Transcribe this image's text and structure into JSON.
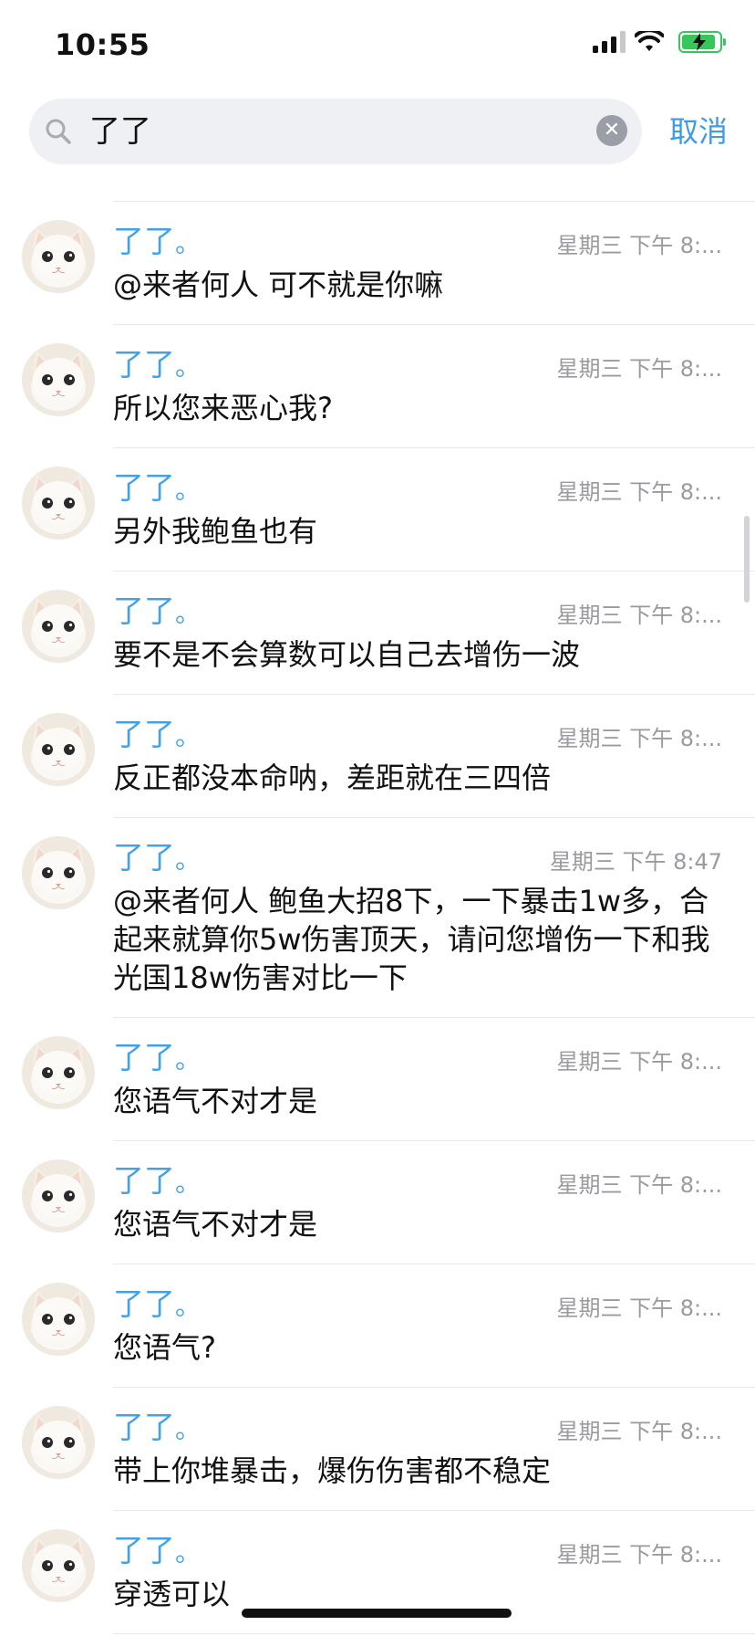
{
  "status_bar": {
    "time": "10:55"
  },
  "search": {
    "query": "了了",
    "cancel_label": "取消"
  },
  "colors": {
    "accent": "#43a2e6",
    "link": "#3d9be9",
    "battery": "#35c759"
  },
  "messages": [
    {
      "name": "了了",
      "dot": "。",
      "time": "星期三 下午 8:...",
      "text": "@来者何人 可不就是你嘛"
    },
    {
      "name": "了了",
      "dot": "。",
      "time": "星期三 下午 8:...",
      "text": "所以您来恶心我?"
    },
    {
      "name": "了了",
      "dot": "。",
      "time": "星期三 下午 8:...",
      "text": "另外我鲍鱼也有"
    },
    {
      "name": "了了",
      "dot": "。",
      "time": "星期三 下午 8:...",
      "text": "要不是不会算数可以自己去增伤一波"
    },
    {
      "name": "了了",
      "dot": "。",
      "time": "星期三 下午 8:...",
      "text": "反正都没本命呐，差距就在三四倍"
    },
    {
      "name": "了了",
      "dot": "。",
      "time": "星期三 下午 8:47",
      "text": "@来者何人 鲍鱼大招8下，一下暴击1w多，合起来就算你5w伤害顶天，请问您增伤一下和我光国18w伤害对比一下"
    },
    {
      "name": "了了",
      "dot": "。",
      "time": "星期三 下午 8:...",
      "text": "您语气不对才是"
    },
    {
      "name": "了了",
      "dot": "。",
      "time": "星期三 下午 8:...",
      "text": "您语气不对才是"
    },
    {
      "name": "了了",
      "dot": "。",
      "time": "星期三 下午 8:...",
      "text": "您语气?"
    },
    {
      "name": "了了",
      "dot": "。",
      "time": "星期三 下午 8:...",
      "text": "带上你堆暴击，爆伤伤害都不稳定"
    },
    {
      "name": "了了",
      "dot": "。",
      "time": "星期三 下午 8:...",
      "text": "穿透可以"
    }
  ]
}
